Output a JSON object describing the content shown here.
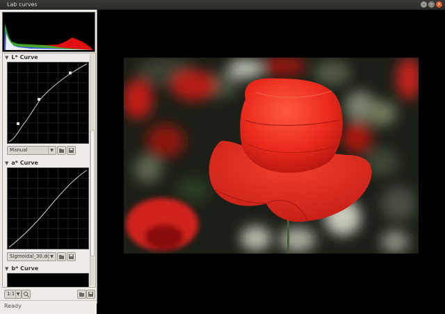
{
  "window": {
    "title": "Lab curves",
    "minimize_icon": "minimize-icon",
    "maximize_icon": "maximize-icon",
    "close_icon": "close-icon"
  },
  "panels": {
    "l_curve": {
      "label": "L* Curve",
      "preset": "Manual"
    },
    "a_curve": {
      "label": "a* Curve",
      "preset": "Sigmoidal_30.dc"
    },
    "b_curve": {
      "label": "b* Curve"
    }
  },
  "bottom": {
    "zoom": "1:1"
  },
  "status": {
    "text": "Ready"
  },
  "colors": {
    "accent": "#e05a2b",
    "panel": "#efebe7",
    "poppy": "#e02a1c"
  },
  "icons": [
    "folder-open-icon",
    "save-icon",
    "zoom-icon"
  ]
}
